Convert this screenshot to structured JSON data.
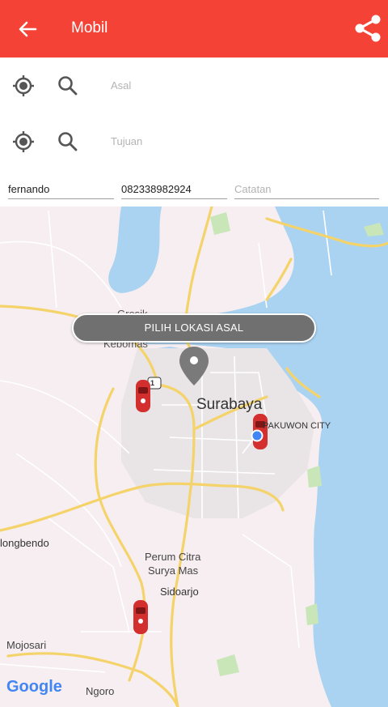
{
  "appbar": {
    "title": "Mobil",
    "back_icon": "arrow-left-icon",
    "share_icon": "share-icon",
    "color": "#f44336"
  },
  "search": {
    "origin_placeholder": "Asal",
    "destination_placeholder": "Tujuan"
  },
  "form": {
    "name_value": "fernando",
    "phone_value": "082338982924",
    "note_placeholder": "Catatan"
  },
  "map": {
    "action_label": "PILIH LOKASI ASAL",
    "labels": {
      "surabaya": "Surabaya",
      "kebomas": "Kebomas",
      "pakuwon": "PAKUWON CITY",
      "tanggulangin": "longbendo",
      "perum_citra_1": "Perum Citra",
      "perum_citra_2": "Surya Mas",
      "sidoarjo": "Sidoarjo",
      "mojosari": "Mojosari",
      "ngoro": "Ngoro",
      "gresik": "Gresik",
      "route_shield": "1"
    },
    "attribution": "Google"
  }
}
